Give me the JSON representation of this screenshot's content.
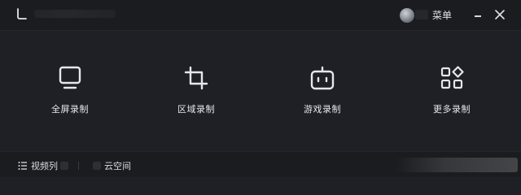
{
  "header": {
    "menu_label": "菜单"
  },
  "tools": [
    {
      "label": "全屏录制",
      "icon": "monitor-icon"
    },
    {
      "label": "区域录制",
      "icon": "crop-icon"
    },
    {
      "label": "游戏录制",
      "icon": "gamepad-icon"
    },
    {
      "label": "更多录制",
      "icon": "grid-more-icon"
    }
  ],
  "footer": {
    "video_list_label": "视频列",
    "cloud_space_label": "云空间"
  },
  "colors": {
    "background": "#1e2025",
    "titlebar": "#1b1c20",
    "text": "#e6e7ea"
  }
}
